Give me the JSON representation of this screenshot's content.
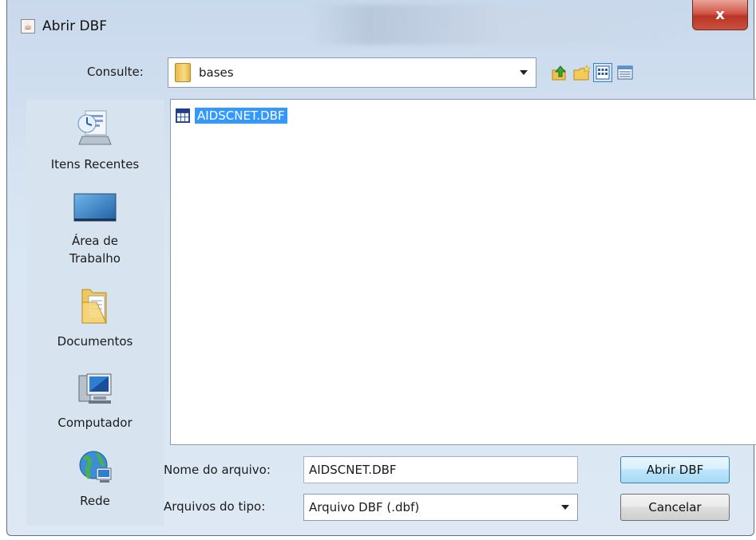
{
  "window": {
    "title": "Abrir DBF",
    "close_label": "x"
  },
  "lookin": {
    "label": "Consulte:",
    "value": "bases"
  },
  "places": [
    {
      "label": "Itens Recentes"
    },
    {
      "label": "Área de\nTrabalho"
    },
    {
      "label": "Documentos"
    },
    {
      "label": "Computador"
    },
    {
      "label": "Rede"
    }
  ],
  "files": [
    {
      "name": "AIDSCNET.DBF",
      "selected": true
    }
  ],
  "filename": {
    "label": "Nome do arquivo:",
    "value": "AIDSCNET.DBF"
  },
  "filetype": {
    "label": "Arquivos do tipo:",
    "value": "Arquivo DBF (.dbf)"
  },
  "buttons": {
    "open": "Abrir DBF",
    "cancel": "Cancelar"
  },
  "icons": {
    "up": "up-folder-icon",
    "new_folder": "new-folder-icon",
    "list_view": "list-view-icon",
    "details_view": "details-view-icon"
  },
  "colors": {
    "selection": "#3399ff",
    "close": "#c9513d"
  }
}
